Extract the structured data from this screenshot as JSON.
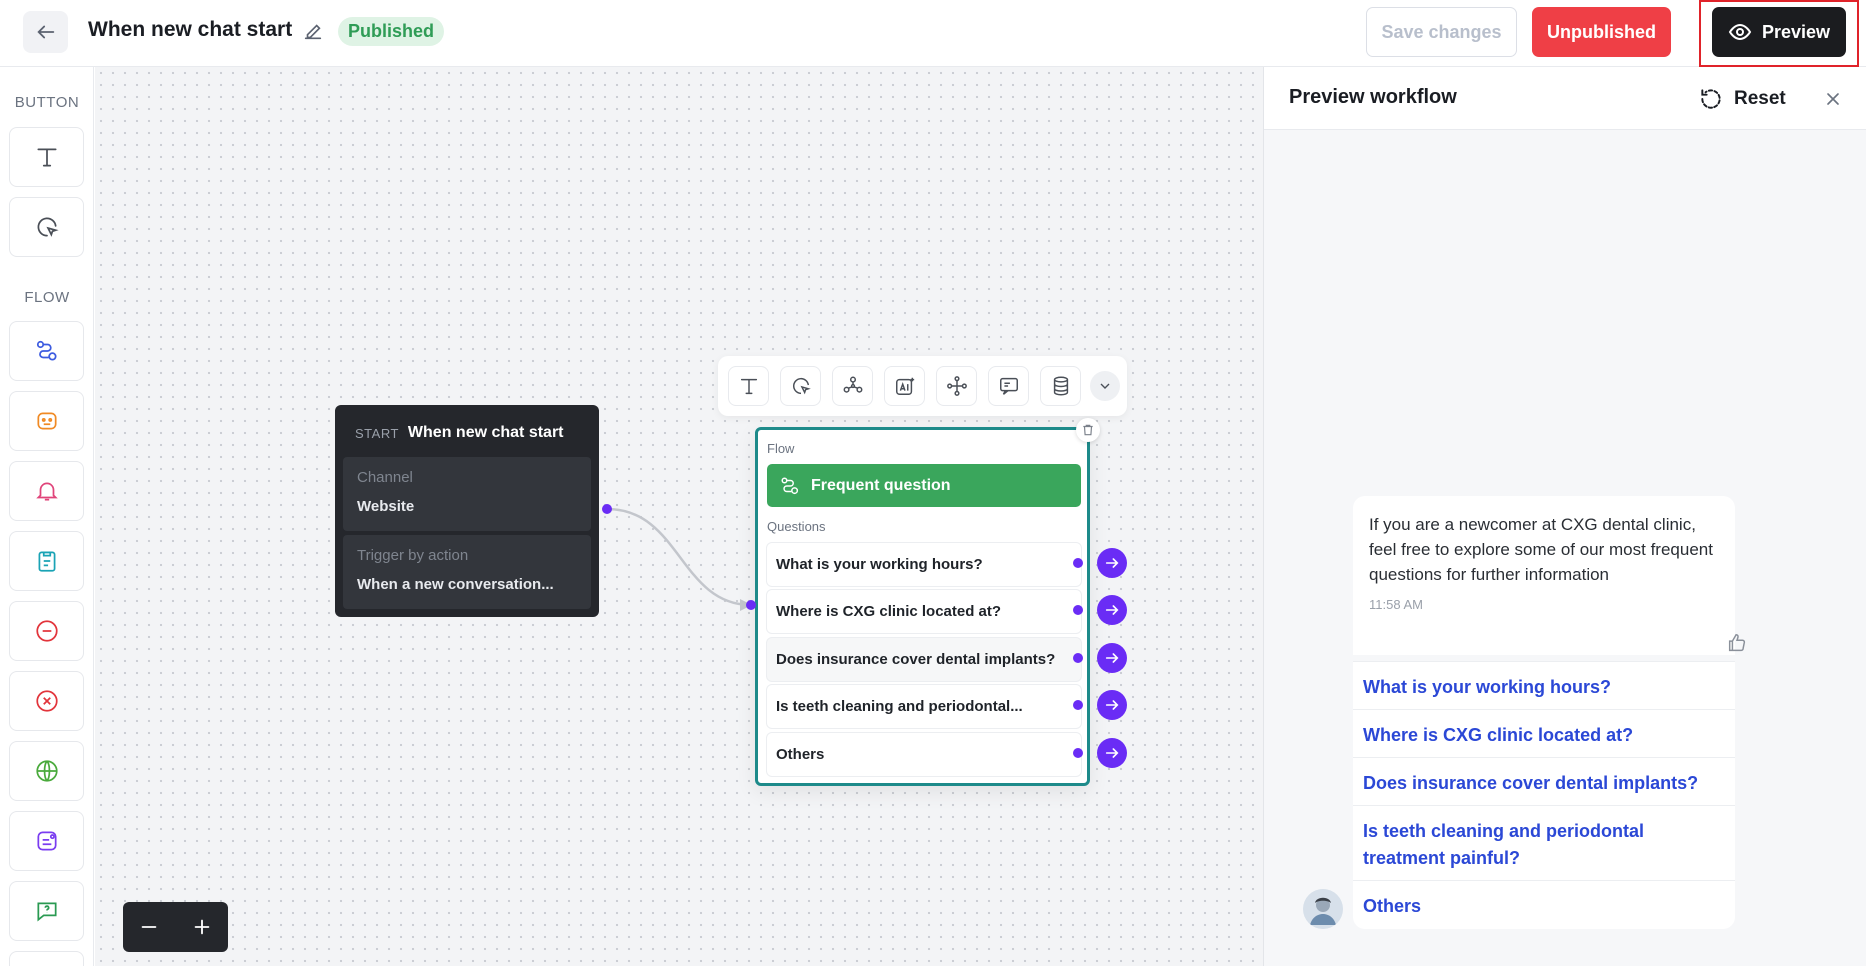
{
  "header": {
    "title": "When new chat start",
    "status": "Published",
    "save_label": "Save changes",
    "unpublish_label": "Unpublished",
    "preview_label": "Preview"
  },
  "toolbox": {
    "sections": [
      "BUTTON",
      "FLOW"
    ],
    "button_tools": [
      "text-tool-icon",
      "pointer-click-icon"
    ],
    "flow_tools": [
      "flow-icon",
      "bot-face-icon",
      "bell-icon",
      "clipboard-icon",
      "minus-circle-icon",
      "x-circle-icon",
      "globe-icon",
      "ai-chat-icon",
      "help-chat-icon"
    ]
  },
  "start_node": {
    "tag": "START",
    "title": "When new chat start",
    "channel_label": "Channel",
    "channel_value": "Website",
    "trigger_label": "Trigger by action",
    "trigger_value": "When a new conversation..."
  },
  "flow_node": {
    "section_label": "Flow",
    "flow_name": "Frequent question",
    "questions_label": "Questions",
    "questions": [
      "What is your working hours?",
      "Where is CXG clinic located at?",
      "Does insurance cover dental implants?",
      "Is teeth cleaning and periodontal...",
      "Others"
    ]
  },
  "toolbar_icons": [
    "text-icon",
    "click-icon",
    "branch-icon",
    "ai-icon",
    "integration-icon",
    "chat-icon",
    "database-icon",
    "chevron-down-icon"
  ],
  "preview": {
    "title": "Preview workflow",
    "reset_label": "Reset",
    "message": "If you are a newcomer at CXG dental clinic, feel free to explore some of our most frequent questions for further information",
    "time": "11:58 AM",
    "options": [
      "What is your working hours?",
      "Where is CXG clinic located at?",
      "Does insurance cover dental implants?",
      "Is teeth cleaning and periodontal treatment painful?",
      "Others"
    ]
  },
  "colors": {
    "published": "#2f9c56",
    "unpublish": "#ef3f46",
    "accent_purple": "#6a2cf5",
    "flow_green": "#3aa65c",
    "link_blue": "#2b48d6"
  }
}
